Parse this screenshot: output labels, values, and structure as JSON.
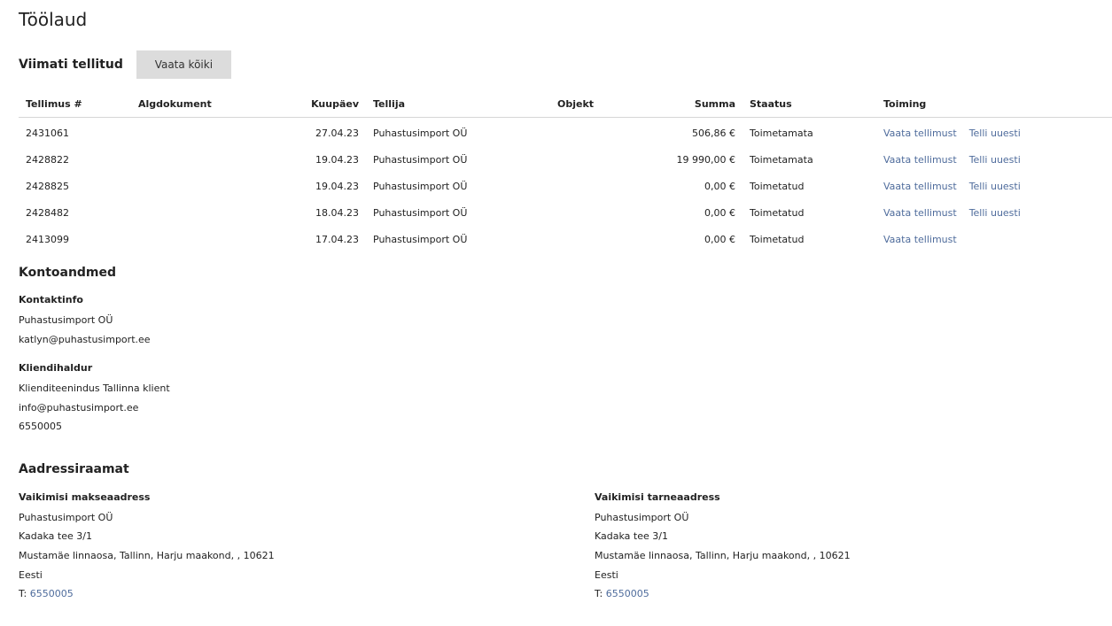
{
  "page": {
    "title": "Töölaud"
  },
  "recent_orders": {
    "title": "Viimati tellitud",
    "view_all_label": "Vaata kõiki",
    "columns": [
      "Tellimus #",
      "Algdokument",
      "Kuupäev",
      "Tellija",
      "Objekt",
      "Summa",
      "Staatus",
      "Toiming"
    ],
    "rows": [
      {
        "order": "2431061",
        "source": "",
        "date": "27.04.23",
        "customer": "Puhastusimport OÜ",
        "object": "",
        "sum": "506,86 €",
        "status": "Toimetamata",
        "view": "Vaata tellimust",
        "reorder": "Telli uuesti"
      },
      {
        "order": "2428822",
        "source": "",
        "date": "19.04.23",
        "customer": "Puhastusimport OÜ",
        "object": "",
        "sum": "19 990,00 €",
        "status": "Toimetamata",
        "view": "Vaata tellimust",
        "reorder": "Telli uuesti"
      },
      {
        "order": "2428825",
        "source": "",
        "date": "19.04.23",
        "customer": "Puhastusimport OÜ",
        "object": "",
        "sum": "0,00 €",
        "status": "Toimetatud",
        "view": "Vaata tellimust",
        "reorder": "Telli uuesti"
      },
      {
        "order": "2428482",
        "source": "",
        "date": "18.04.23",
        "customer": "Puhastusimport OÜ",
        "object": "",
        "sum": "0,00 €",
        "status": "Toimetatud",
        "view": "Vaata tellimust",
        "reorder": "Telli uuesti"
      },
      {
        "order": "2413099",
        "source": "",
        "date": "17.04.23",
        "customer": "Puhastusimport OÜ",
        "object": "",
        "sum": "0,00 €",
        "status": "Toimetatud",
        "view": "Vaata tellimust",
        "reorder": ""
      }
    ]
  },
  "account": {
    "title": "Kontoandmed",
    "contact": {
      "title": "Kontaktinfo",
      "name": "Puhastusimport OÜ",
      "email": "katlyn@puhastusimport.ee"
    },
    "manager": {
      "title": "Kliendihaldur",
      "name": "Klienditeenindus Tallinna klient",
      "email": "info@puhastusimport.ee",
      "phone": "6550005"
    }
  },
  "address_book": {
    "title": "Aadressiraamat",
    "billing": {
      "title": "Vaikimisi makseaadress",
      "name": "Puhastusimport OÜ",
      "street": "Kadaka tee 3/1",
      "region": "Mustamäe linnaosa, Tallinn, Harju maakond, , 10621",
      "country": "Eesti",
      "phone_prefix": "T: ",
      "phone": "6550005"
    },
    "shipping": {
      "title": "Vaikimisi tarneaadress",
      "name": "Puhastusimport OÜ",
      "street": "Kadaka tee 3/1",
      "region": "Mustamäe linnaosa, Tallinn, Harju maakond, , 10621",
      "country": "Eesti",
      "phone_prefix": "T: ",
      "phone": "6550005"
    }
  },
  "colors": {
    "link": "#4f6c9c",
    "button_bg": "#dcdcdc",
    "divider": "#d5d5d5"
  }
}
